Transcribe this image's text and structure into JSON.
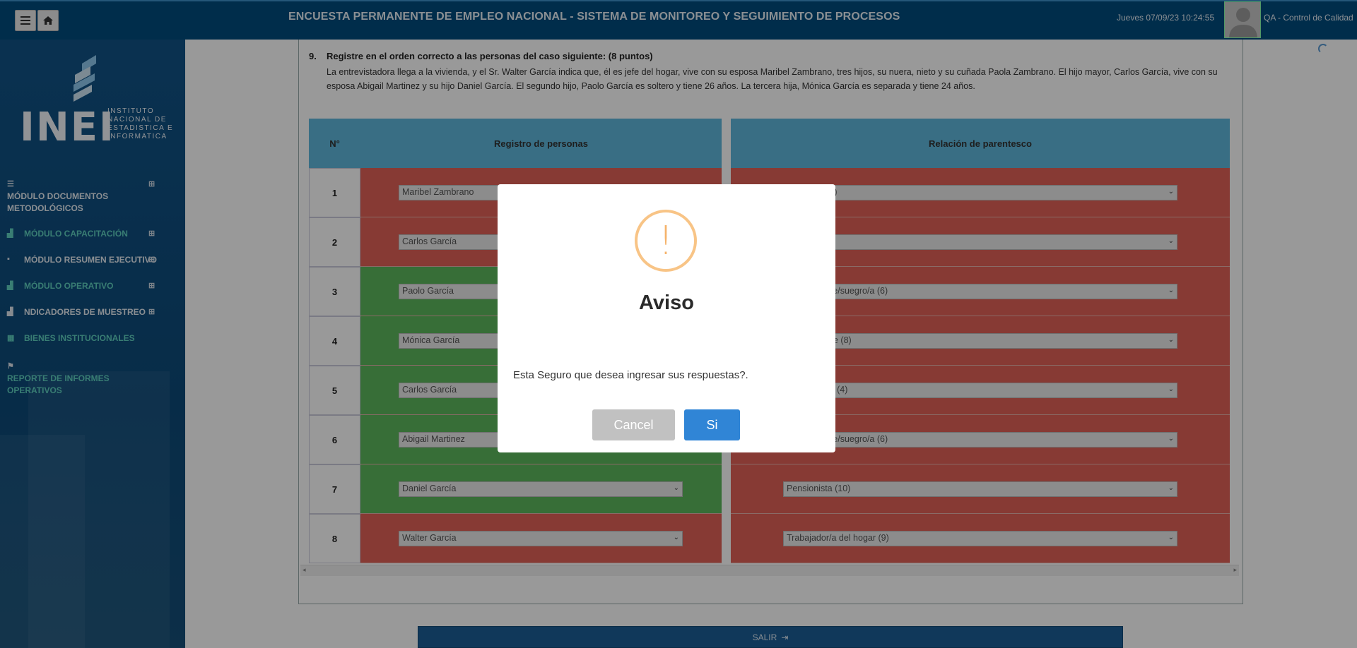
{
  "header": {
    "title": "ENCUESTA PERMANENTE DE EMPLEO NACIONAL - SISTEMA DE MONITOREO Y SEGUIMIENTO DE PROCESOS",
    "datetime": "Jueves 07/09/23 10:24:55",
    "user": "QA - Control de Calidad",
    "menu_icon": "hamburger-icon",
    "home_icon": "home-icon"
  },
  "sidebar": {
    "logo_text": "INEI",
    "logo_sub": "INSTITUTO\nNACIONAL DE\nESTADISTICA E\nINFORMATICA",
    "items": [
      {
        "label": "MÓDULO DOCUMENTOS METODOLÓGICOS",
        "icon": "database-icon",
        "expand": "⊞"
      },
      {
        "label": "MÓDULO CAPACITACIÓN",
        "icon": "bar-chart-icon",
        "expand": "⊞"
      },
      {
        "label": "MÓDULO RESUMEN EJECUTIVO",
        "icon": "briefcase-icon",
        "expand": "⊞"
      },
      {
        "label": "MÓDULO OPERATIVO",
        "icon": "bar-chart-icon",
        "expand": "⊞"
      },
      {
        "label": "NDICADORES DE MUESTREO",
        "icon": "bar-chart-icon",
        "expand": "⊞"
      },
      {
        "label": "BIENES INSTITUCIONALES",
        "icon": "table-icon",
        "expand": ""
      },
      {
        "label": "REPORTE DE INFORMES OPERATIVOS",
        "icon": "flag-icon",
        "expand": ""
      }
    ]
  },
  "question": {
    "number": "9.",
    "title": "Registre en el orden correcto a las personas del caso siguiente: (8 puntos)",
    "text": "La entrevistadora llega a la vivienda, y el Sr. Walter García indica que, él es jefe del hogar, vive con su esposa Maribel Zambrano, tres hijos, su nuera, nieto y su cuñada Paola Zambrano. El hijo mayor, Carlos García, vive con su esposa Abigail Martinez y su hijo Daniel García. El segundo hijo, Paolo García es soltero y tiene 26 años. La tercera hija, Mónica García es separada y tiene 24 años."
  },
  "table": {
    "headers": [
      "N°",
      "Registro de personas",
      "Relación de parentesco"
    ],
    "rows": [
      {
        "n": "1",
        "persona": "Maribel Zambrano",
        "parentesco": "Hijastro/a (3)",
        "p_status": "red",
        "r_status": "red"
      },
      {
        "n": "2",
        "persona": "Carlos García",
        "parentesco": "",
        "p_status": "red",
        "r_status": "red"
      },
      {
        "n": "3",
        "persona": "Paolo García",
        "parentesco": "Padre/madre/suegro/a (6)",
        "p_status": "green",
        "r_status": "red"
      },
      {
        "n": "4",
        "persona": "Mónica García",
        "parentesco": "Otro pariente (8)",
        "p_status": "green",
        "r_status": "red"
      },
      {
        "n": "5",
        "persona": "Carlos García",
        "parentesco": "Yerno/nuera (4)",
        "p_status": "green",
        "r_status": "red"
      },
      {
        "n": "6",
        "persona": "Abigail Martinez",
        "parentesco": "Padre/madre/suegro/a (6)",
        "p_status": "green",
        "r_status": "red"
      },
      {
        "n": "7",
        "persona": "Daniel García",
        "parentesco": "Pensionista (10)",
        "p_status": "green",
        "r_status": "red"
      },
      {
        "n": "8",
        "persona": "Walter García",
        "parentesco": "Trabajador/a del hogar (9)",
        "p_status": "red",
        "r_status": "red"
      }
    ],
    "visible_parentesco": [
      "...astro/a (3)",
      "",
      "...re/suegro/a (6)",
      "...te (8)",
      "...era (4)",
      "...re/suegro/a (6)",
      "Pensionista (10)",
      "Trabajador/a del hogar (9)"
    ]
  },
  "footer": {
    "salir_label": "SALIR"
  },
  "modal": {
    "icon": "warning-icon",
    "title": "Aviso",
    "message": "Esta Seguro que desea ingresar sus respuestas?.",
    "cancel_label": "Cancel",
    "confirm_label": "Si"
  },
  "colors": {
    "header": "#004c7d",
    "sidebar": "#0d4e80",
    "correct": "#5cb85c",
    "incorrect": "#e26257",
    "table_header": "#5fb8dc",
    "confirm": "#3085d6",
    "cancel": "#c1c1c1",
    "warning": "#f8c486"
  }
}
